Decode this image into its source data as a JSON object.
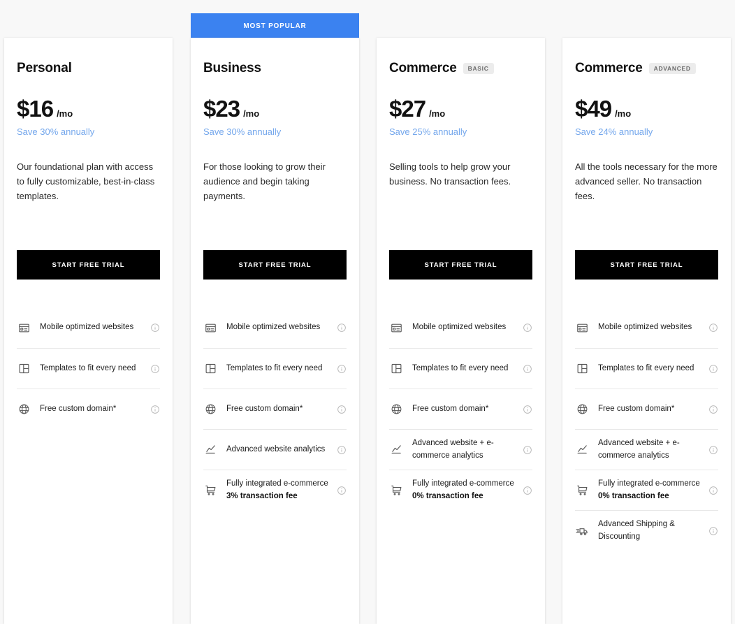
{
  "ribbon": {
    "label": "MOST POPULAR",
    "color": "#3b82f0"
  },
  "theme": {
    "background": "#f8f8f8",
    "card_background": "#ffffff",
    "cta_background": "#000000",
    "save_link_color": "#74a7ec",
    "badge_background": "#ececec",
    "divider_color": "#e8e8e8"
  },
  "cta_label": "START FREE TRIAL",
  "plans": [
    {
      "name": "Personal",
      "badge": "",
      "price": "$16",
      "period": "/mo",
      "save": "Save 30% annually",
      "description": "Our foundational plan with access to fully customizable, best-in-class templates.",
      "features": [
        {
          "icon": "browser-window-icon",
          "text": "Mobile optimized websites",
          "sub": ""
        },
        {
          "icon": "layout-grid-icon",
          "text": "Templates to fit every need",
          "sub": ""
        },
        {
          "icon": "globe-icon",
          "text": "Free custom domain*",
          "sub": ""
        }
      ]
    },
    {
      "name": "Business",
      "badge": "",
      "price": "$23",
      "period": "/mo",
      "save": "Save 30% annually",
      "description": "For those looking to grow their audience and begin taking payments.",
      "features": [
        {
          "icon": "browser-window-icon",
          "text": "Mobile optimized websites",
          "sub": ""
        },
        {
          "icon": "layout-grid-icon",
          "text": "Templates to fit every need",
          "sub": ""
        },
        {
          "icon": "globe-icon",
          "text": "Free custom domain*",
          "sub": ""
        },
        {
          "icon": "analytics-chart-icon",
          "text": "Advanced website analytics",
          "sub": ""
        },
        {
          "icon": "shopping-cart-icon",
          "text": "Fully integrated e-commerce",
          "sub": "3% transaction fee"
        }
      ]
    },
    {
      "name": "Commerce",
      "badge": "BASIC",
      "price": "$27",
      "period": "/mo",
      "save": "Save 25% annually",
      "description": "Selling tools to help grow your business. No transaction fees.",
      "features": [
        {
          "icon": "browser-window-icon",
          "text": "Mobile optimized websites",
          "sub": ""
        },
        {
          "icon": "layout-grid-icon",
          "text": "Templates to fit every need",
          "sub": ""
        },
        {
          "icon": "globe-icon",
          "text": "Free custom domain*",
          "sub": ""
        },
        {
          "icon": "analytics-chart-icon",
          "text": "Advanced website + e-commerce analytics",
          "sub": ""
        },
        {
          "icon": "shopping-cart-icon",
          "text": "Fully integrated e-commerce",
          "sub": "0% transaction fee"
        }
      ]
    },
    {
      "name": "Commerce",
      "badge": "ADVANCED",
      "price": "$49",
      "period": "/mo",
      "save": "Save 24% annually",
      "description": "All the tools necessary for the more advanced seller. No transaction fees.",
      "features": [
        {
          "icon": "browser-window-icon",
          "text": "Mobile optimized websites",
          "sub": ""
        },
        {
          "icon": "layout-grid-icon",
          "text": "Templates to fit every need",
          "sub": ""
        },
        {
          "icon": "globe-icon",
          "text": "Free custom domain*",
          "sub": ""
        },
        {
          "icon": "analytics-chart-icon",
          "text": "Advanced website + e-commerce analytics",
          "sub": ""
        },
        {
          "icon": "shopping-cart-icon",
          "text": "Fully integrated e-commerce",
          "sub": "0% transaction fee"
        },
        {
          "icon": "delivery-truck-icon",
          "text": "Advanced Shipping & Discounting",
          "sub": ""
        }
      ]
    }
  ]
}
